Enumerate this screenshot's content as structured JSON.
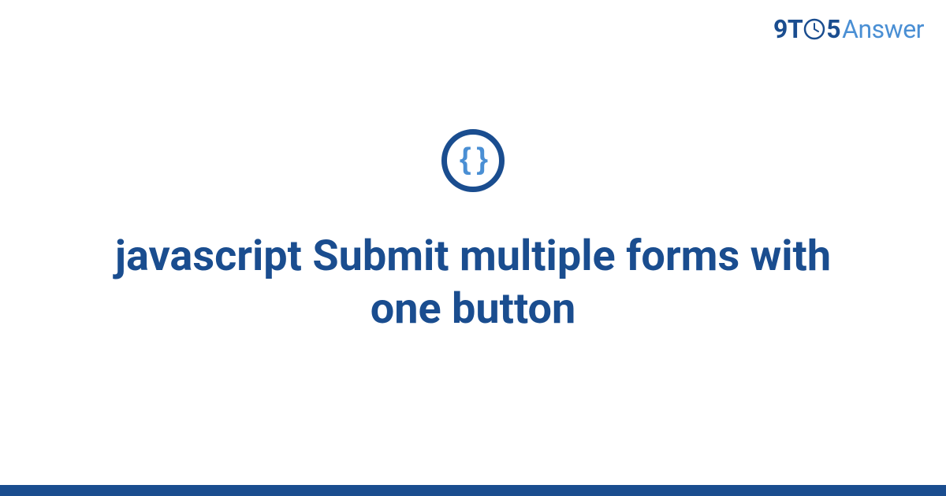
{
  "logo": {
    "part1": "9T",
    "part2": "5",
    "part3": "Answer"
  },
  "icon": {
    "braces": "{ }"
  },
  "title": "javascript Submit multiple forms with one button",
  "colors": {
    "primary": "#1a4d8f",
    "accent": "#4a8fd4"
  }
}
